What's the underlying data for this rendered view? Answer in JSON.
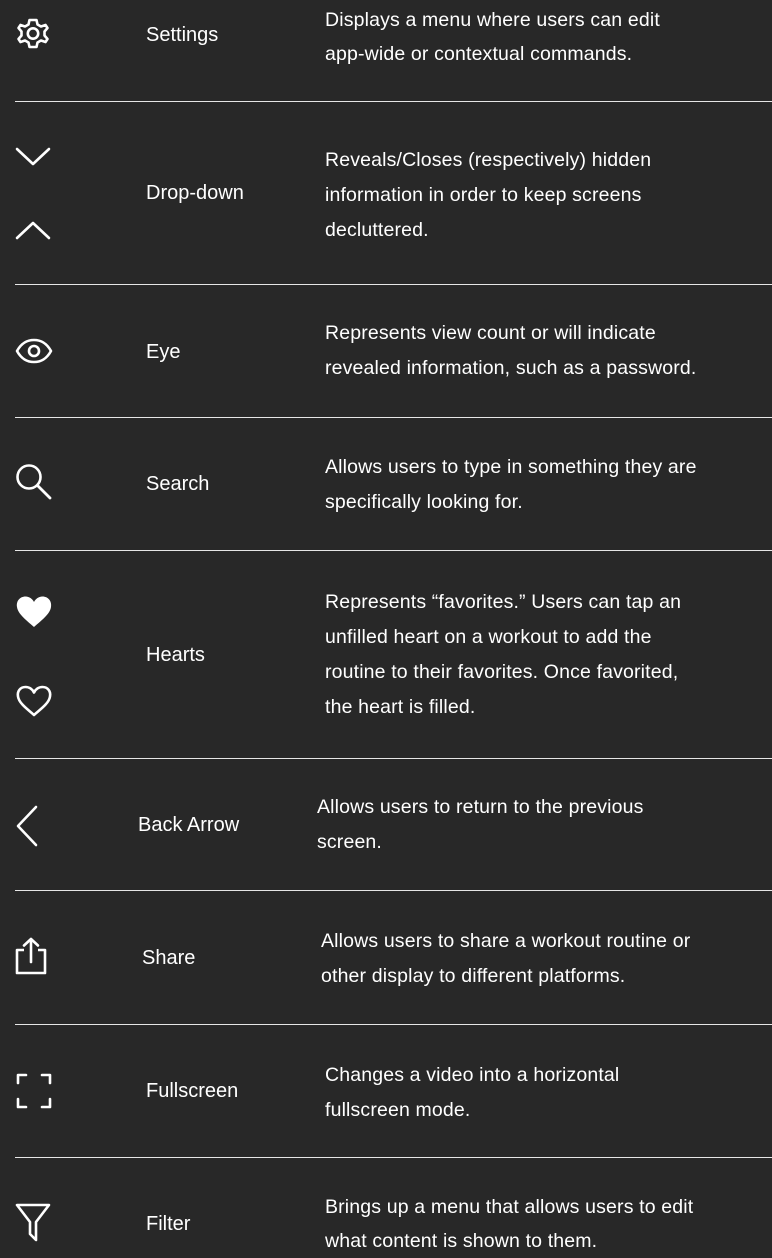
{
  "colors": {
    "background": "#282828",
    "text": "#ffffff",
    "divider": "#e6e6e6"
  },
  "rows": [
    {
      "name": "Settings",
      "icons": [
        "gear-icon"
      ],
      "description_lines": [
        "Displays a menu where users can edit",
        "app-wide or contextual commands."
      ]
    },
    {
      "name": "Drop-down",
      "icons": [
        "chevron-down-icon",
        "chevron-up-icon"
      ],
      "description_lines": [
        "Reveals/Closes (respectively)  hidden",
        "information in order to keep screens",
        "decluttered."
      ]
    },
    {
      "name": "Eye",
      "icons": [
        "eye-icon"
      ],
      "description_lines": [
        "Represents view count or will indicate",
        "revealed information, such as a password."
      ]
    },
    {
      "name": "Search",
      "icons": [
        "search-icon"
      ],
      "description_lines": [
        "Allows users to type in something they are",
        "specifically looking for."
      ]
    },
    {
      "name": "Hearts",
      "icons": [
        "heart-filled-icon",
        "heart-outline-icon"
      ],
      "description_lines": [
        "Represents “favorites.” Users can tap an",
        "unfilled heart on a workout to add the",
        "routine to their favorites. Once favorited,",
        "the heart is filled."
      ]
    },
    {
      "name": "Back Arrow",
      "icons": [
        "back-arrow-icon"
      ],
      "description_lines": [
        "Allows users to return to the previous",
        "screen."
      ]
    },
    {
      "name": "Share",
      "icons": [
        "share-icon"
      ],
      "description_lines": [
        "Allows users to share a workout routine or",
        "other display to different platforms."
      ]
    },
    {
      "name": "Fullscreen",
      "icons": [
        "fullscreen-icon"
      ],
      "description_lines": [
        "Changes a video into a horizontal",
        "fullscreen mode."
      ]
    },
    {
      "name": "Filter",
      "icons": [
        "filter-icon"
      ],
      "description_lines": [
        "Brings up a menu that allows users to edit",
        "what content is shown to them."
      ]
    }
  ]
}
